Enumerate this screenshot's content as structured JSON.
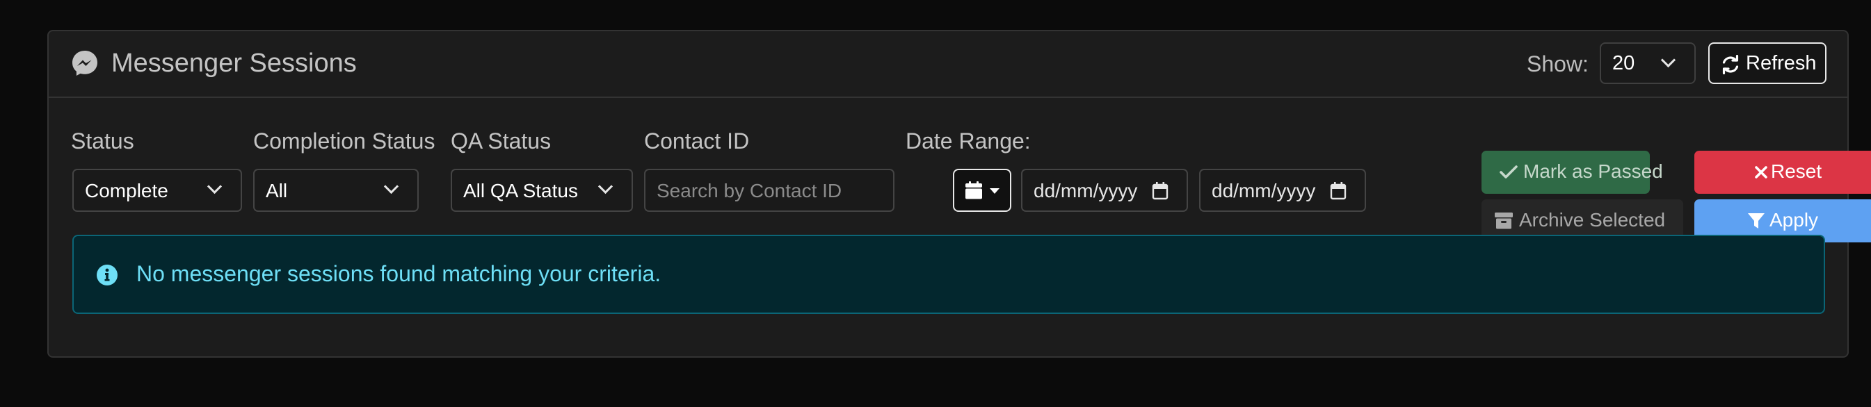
{
  "header": {
    "title": "Messenger Sessions",
    "icon": "messenger-icon",
    "show_label": "Show:",
    "show_value": "20",
    "refresh_label": "Refresh"
  },
  "filters": {
    "status": {
      "label": "Status",
      "value": "Complete"
    },
    "completion_status": {
      "label": "Completion Status",
      "value": "All"
    },
    "qa_status": {
      "label": "QA Status",
      "value": "All QA Status"
    },
    "contact_id": {
      "label": "Contact ID",
      "placeholder": "Search by Contact ID"
    },
    "date_range": {
      "label": "Date Range:",
      "from": "dd/mm/yyyy",
      "to": "dd/mm/yyyy"
    }
  },
  "actions": {
    "mark_passed": "Mark as Passed",
    "reset": "Reset",
    "archive": "Archive Selected",
    "apply": "Apply"
  },
  "alert": {
    "message": "No messenger sessions found matching your criteria."
  },
  "colors": {
    "background": "#0b0b0b",
    "card": "#1c1c1c",
    "success": "#2f6a46",
    "danger": "#dc3545",
    "primary": "#5ea1f2",
    "info_text": "#6edff6",
    "info_bg": "#03272e"
  }
}
